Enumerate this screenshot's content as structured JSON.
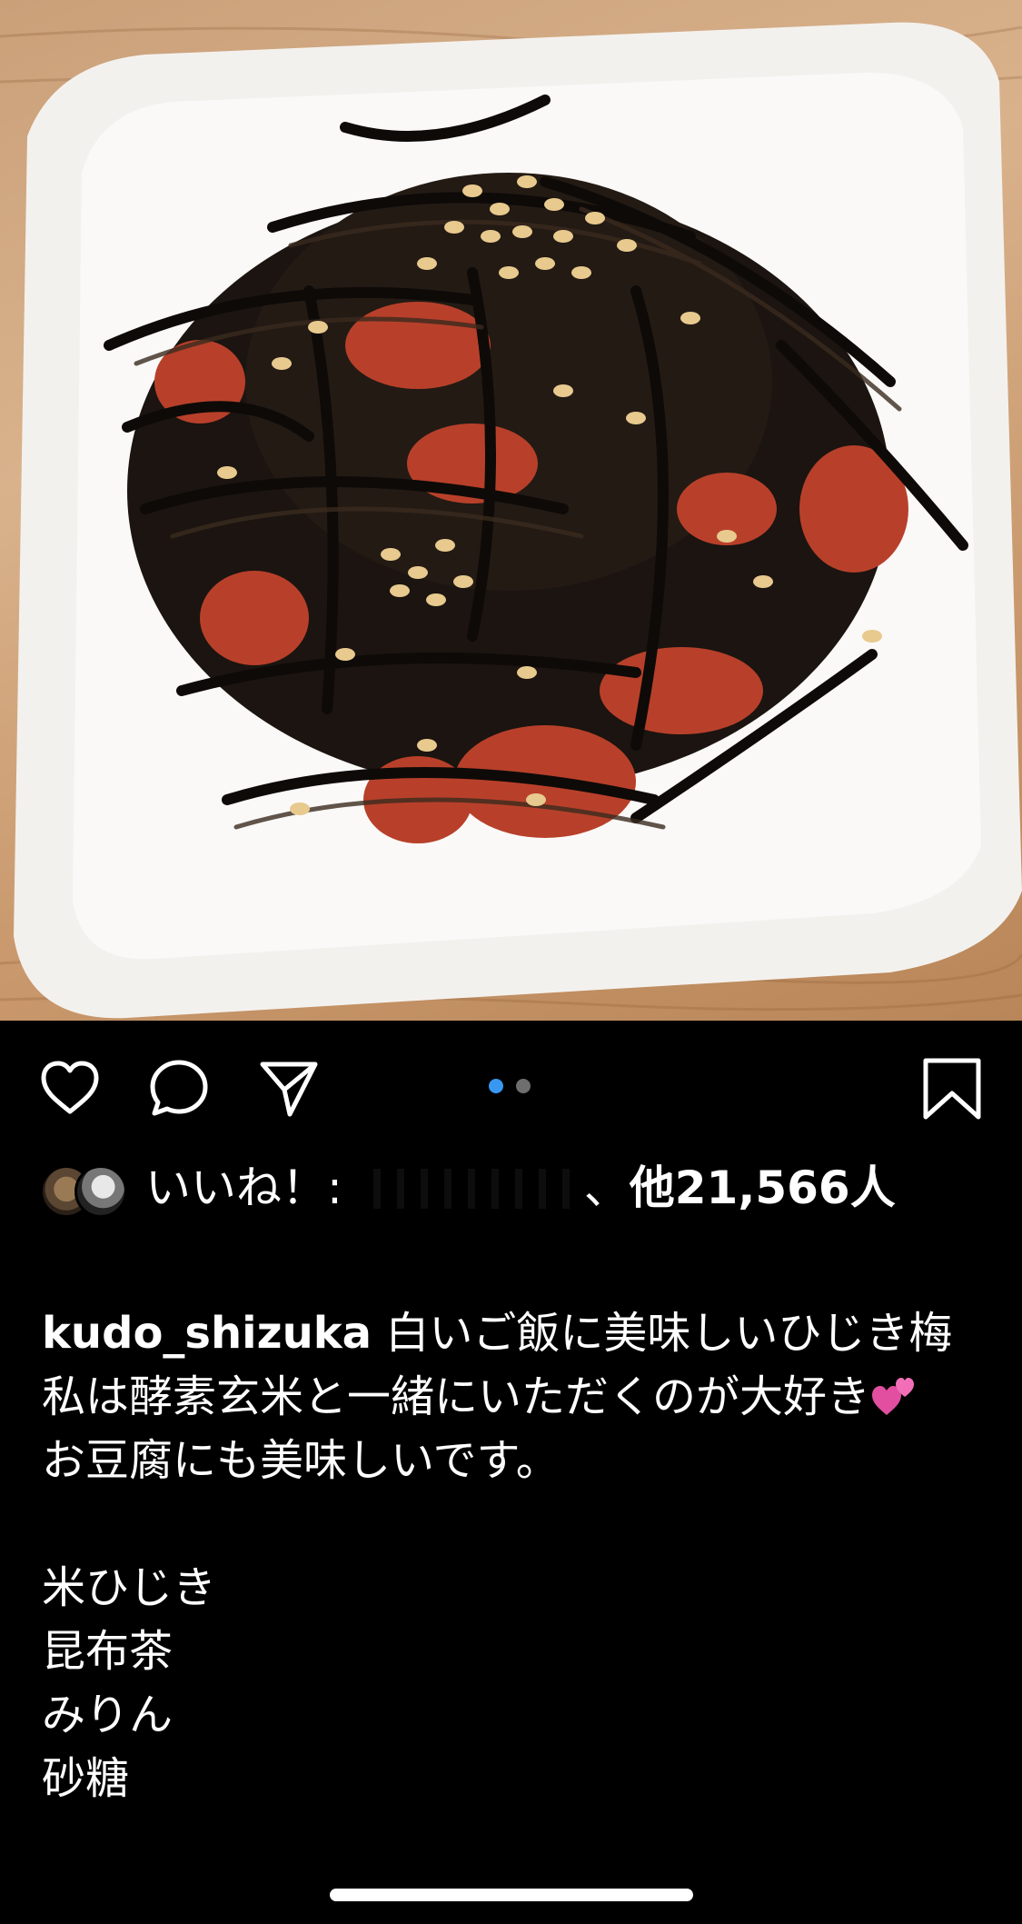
{
  "post": {
    "username": "kudo_shizuka",
    "caption_lines": [
      "白いご飯に美味しいひじき梅",
      "私は酵素玄米と一緒にいただくのが大好き",
      "お豆腐にも美味しいです。",
      "",
      "米ひじき",
      "昆布茶",
      "みりん",
      "砂糖"
    ],
    "caption_emoji": "heart-emoji"
  },
  "likes": {
    "prefix": "いいね！: ",
    "suffix": "、",
    "others": "他21,566人"
  },
  "actions": {
    "like_icon": "heart-outline-icon",
    "comment_icon": "comment-bubble-icon",
    "share_icon": "paper-plane-icon",
    "save_icon": "bookmark-outline-icon"
  },
  "carousel": {
    "total": 2,
    "active_index": 0,
    "active_color": "#3897f0",
    "inactive_color": "#6e6e6e"
  },
  "colors": {
    "background": "#000000",
    "text": "#ffffff"
  }
}
